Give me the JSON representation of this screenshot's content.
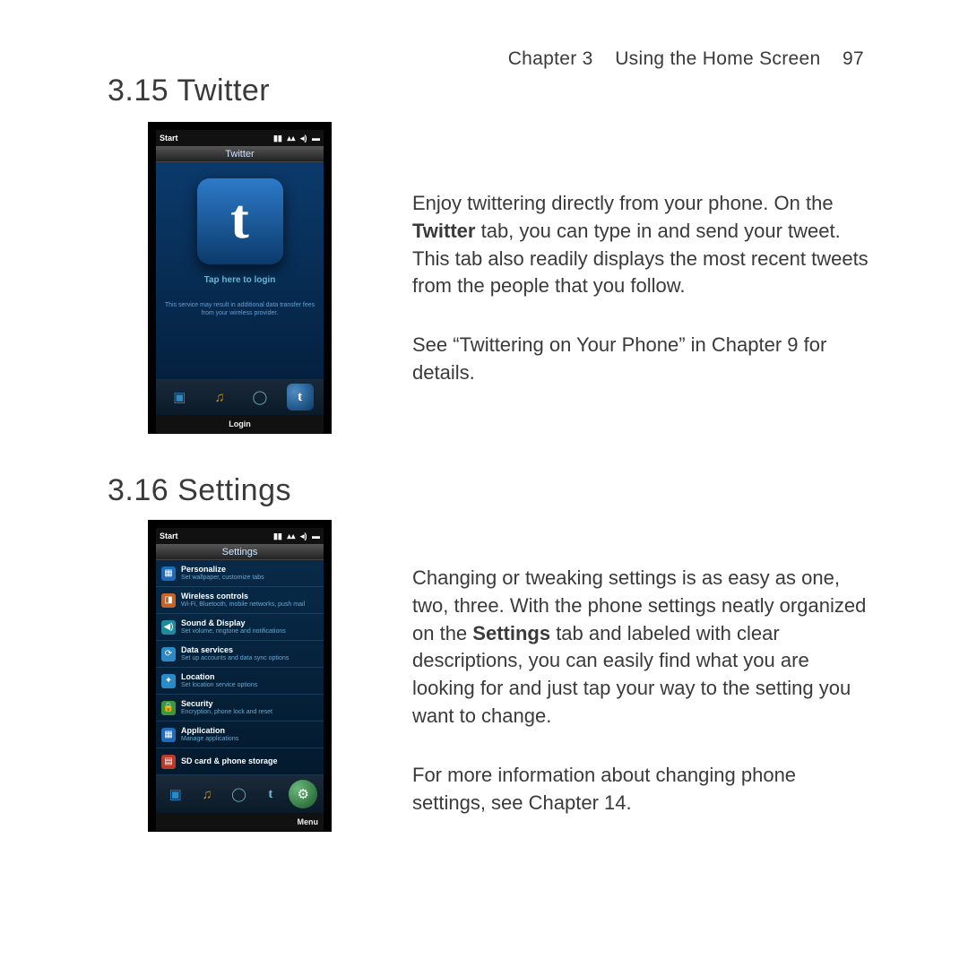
{
  "page_header": {
    "chapter": "Chapter 3",
    "title": "Using the Home Screen",
    "page": "97"
  },
  "section_twitter": {
    "heading": "3.15  Twitter",
    "para1_a": "Enjoy twittering directly from your phone. On the ",
    "para1_bold": "Twitter",
    "para1_b": " tab, you can type in and send your tweet. This tab also readily displays the most recent tweets from the people that you follow.",
    "para2": "See “Twittering on Your Phone” in Chapter 9 for details."
  },
  "section_settings": {
    "heading": "3.16  Settings",
    "para1_a": "Changing or tweaking settings is as easy as one, two, three. With the phone settings neatly organized on the ",
    "para1_bold": "Settings",
    "para1_b": " tab and labeled with clear descriptions, you can easily find what you are looking for and just tap your way to the setting you want to change.",
    "para2": "For more information about changing phone settings, see Chapter 14."
  },
  "phone_twitter": {
    "status_start": "Start",
    "title": "Twitter",
    "login": "Tap here to login",
    "disclaimer": "This service may result in additional data transfer fees from your wireless provider.",
    "bottom": "Login"
  },
  "phone_settings": {
    "status_start": "Start",
    "title": "Settings",
    "items": [
      {
        "title": "Personalize",
        "sub": "Set wallpaper, customize tabs"
      },
      {
        "title": "Wireless controls",
        "sub": "Wi-Fi, Bluetooth, mobile networks, push mail"
      },
      {
        "title": "Sound & Display",
        "sub": "Set volume, ringtone and notifications"
      },
      {
        "title": "Data services",
        "sub": "Set up accounts and data sync options"
      },
      {
        "title": "Location",
        "sub": "Set location service options"
      },
      {
        "title": "Security",
        "sub": "Encryption, phone lock and reset"
      },
      {
        "title": "Application",
        "sub": "Manage applications"
      },
      {
        "title": "SD card & phone storage",
        "sub": ""
      }
    ],
    "bottom": "Menu"
  }
}
